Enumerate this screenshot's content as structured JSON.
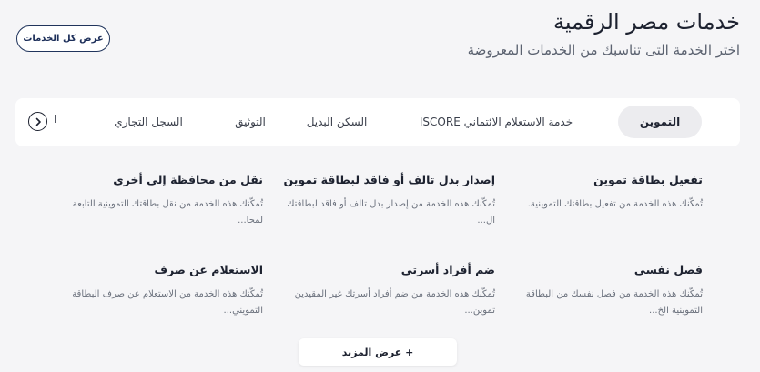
{
  "header": {
    "title": "خدمات مصر الرقمية",
    "subtitle": "اختر الخدمة التى تناسبك من الخدمات المعروضة",
    "view_all_label": "عرض كل الخدمات"
  },
  "tabs": [
    {
      "label": "التموين",
      "active": true
    },
    {
      "label": "خدمة الاستعلام الائتماني ISCORE",
      "active": false
    },
    {
      "label": "السكن البديل",
      "active": false
    },
    {
      "label": "التوثيق",
      "active": false
    },
    {
      "label": "السجل التجاري",
      "active": false
    },
    {
      "label": "ا",
      "active": false
    }
  ],
  "cards": [
    {
      "title": "تفعيل بطاقة تموين",
      "desc": "تُمكّنك هذه الخدمة من تفعيل بطاقتك التموينية."
    },
    {
      "title": "إصدار بدل تالف أو فاقد لبطاقة تموين",
      "desc": "تُمكّنك هذه الخدمة من إصدار بدل تالف أو فاقد لبطاقتك ال..."
    },
    {
      "title": "نقل من محافظة إلى أخرى",
      "desc": "تُمكّنك هذه الخدمة من نقل بطاقتك التموينية التابعة لمحا..."
    },
    {
      "title": "فصل نفسي",
      "desc": "تُمكّنك هذه الخدمة من فصل نفسك من البطاقة التموينية الخ..."
    },
    {
      "title": "ضم أفراد أسرتى",
      "desc": "تُمكّنك هذه الخدمة من ضم أفراد أسرتك غير المقيدين تموين..."
    },
    {
      "title": "الاستعلام عن صرف",
      "desc": "تُمكّنك هذه الخدمة من الاستعلام عن صرف البطاقة التمويني..."
    }
  ],
  "more_label": "+ عرض المزيد",
  "colors": {
    "background": "#f5f5f7",
    "accent": "#20345c",
    "active_tab": "#ececef"
  }
}
